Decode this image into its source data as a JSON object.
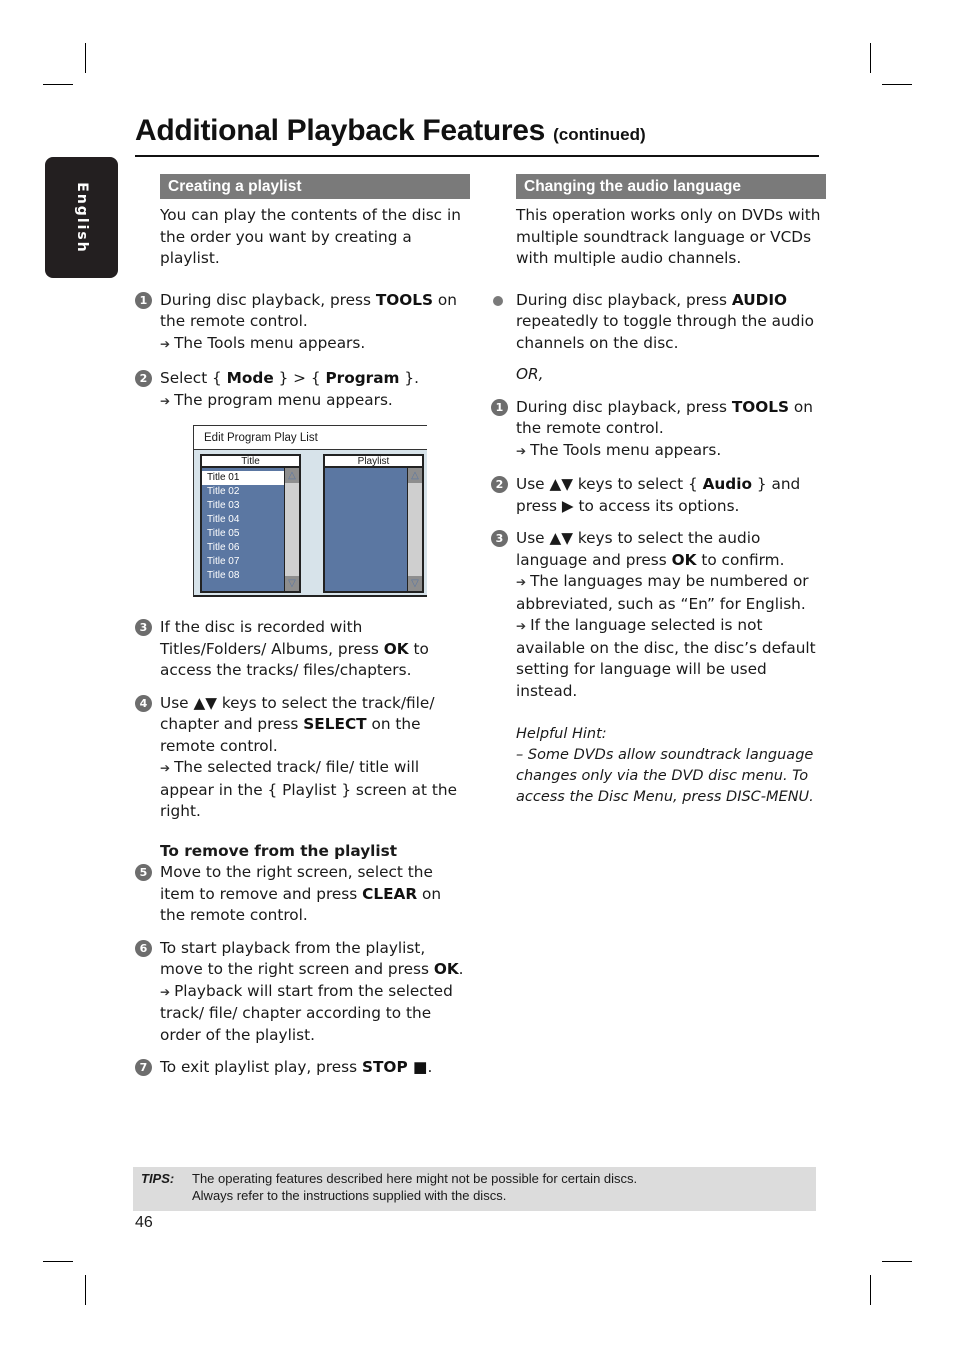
{
  "page": {
    "title": "Additional Playback Features",
    "title_suffix": "(continued)",
    "language_tab": "English",
    "page_number": "46"
  },
  "left": {
    "heading": "Creating a playlist",
    "intro": "You can play the contents of the disc in the order you want by creating a playlist.",
    "steps": [
      {
        "num": "1",
        "pre": "During disc playback, press ",
        "bold": "TOOLS",
        "post": " on the remote control.",
        "result": "The Tools menu appears."
      },
      {
        "num": "2",
        "pre": "Select { ",
        "bold": "Mode",
        "mid": " } > { ",
        "bold2": "Program",
        "post": " }.",
        "result": "The program menu appears."
      },
      {
        "num": "3",
        "pre": "If the disc is recorded with Titles/Folders/ Albums, press ",
        "bold": "OK",
        "post": " to access the tracks/ files/chapters."
      },
      {
        "num": "4",
        "pre": "Use ▲▼ keys to select the track/file/ chapter and press ",
        "bold": "SELECT",
        "post": " on the remote control.",
        "result": "The selected track/ file/ title will appear in the { Playlist } screen at the right."
      },
      {
        "num": "5",
        "pre": "Move to the right screen, select the item to remove and press ",
        "bold": "CLEAR",
        "post": " on the remote control."
      },
      {
        "num": "6",
        "pre": "To start playback from the playlist, move to the right screen and press ",
        "bold": "OK",
        "post": ".",
        "result": "Playback will start from the selected track/ file/ chapter according to the order of the playlist."
      },
      {
        "num": "7",
        "pre": "To exit playlist play, press ",
        "bold": "STOP ■",
        "post": "."
      }
    ],
    "remove_heading": "To remove from the playlist",
    "widget": {
      "title": "Edit Program Play List",
      "left_header": "Title",
      "right_header": "Playlist",
      "items": [
        "Title 01",
        "Title 02",
        "Title 03",
        "Title 04",
        "Title 05",
        "Title 06",
        "Title 07",
        "Title 08"
      ],
      "selected_index": 0,
      "scroll_up": "△",
      "scroll_down": "▽"
    }
  },
  "right": {
    "heading": "Changing the audio language",
    "intro": "This operation works only on DVDs with multiple soundtrack language or VCDs with multiple audio channels.",
    "bullet": {
      "pre": "During disc playback, press ",
      "bold": "AUDIO",
      "post": " repeatedly to toggle through the audio channels on the disc."
    },
    "or": "OR,",
    "steps": [
      {
        "num": "1",
        "pre": "During disc playback, press ",
        "bold": "TOOLS",
        "post": " on the remote control.",
        "result": "The Tools menu appears."
      },
      {
        "num": "2",
        "pre": "Use ▲▼ keys to select { ",
        "bold": "Audio",
        "post": " } and press ▶ to access its options."
      },
      {
        "num": "3",
        "pre": "Use ▲▼ keys to select the audio language and press ",
        "bold": "OK",
        "post": " to confirm.",
        "result": "The languages may be numbered or abbreviated, such as “En” for English.",
        "result2": "If the language selected is not available on the disc, the disc’s default setting for language will be used instead."
      }
    ],
    "hint_label": "Helpful Hint:",
    "hint_text": "–  Some DVDs allow soundtrack language changes only via the DVD disc menu. To access the Disc Menu, press DISC-MENU."
  },
  "tips": {
    "label": "TIPS:",
    "line1": "The operating features described here might not be possible for certain discs.",
    "line2": "Always refer to the instructions supplied with the discs."
  },
  "icons": {
    "result_arrow": "➔"
  }
}
